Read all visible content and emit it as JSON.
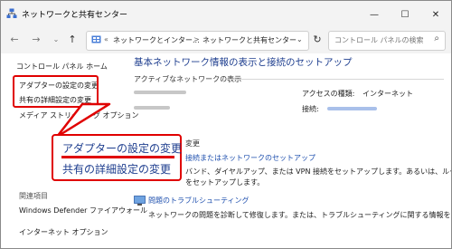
{
  "window": {
    "title": "ネットワークと共有センター",
    "controls": {
      "minimize": "—",
      "maximize": "☐",
      "close": "✕"
    }
  },
  "nav": {
    "back": "←",
    "forward": "→",
    "up": "↑",
    "refresh": "↻"
  },
  "address": {
    "sep": "«",
    "crumb1": "ネットワークとインター...",
    "arrow": ">",
    "crumb2": "ネットワークと共有センター",
    "dropdown": "⌄"
  },
  "search": {
    "placeholder": "コントロール パネルの検索",
    "icon": "⌕"
  },
  "sidebar": {
    "home": "コントロール パネル ホーム",
    "adapter": "アダプターの設定の変更",
    "sharing": "共有の詳細設定の変更",
    "media": "メディア ストリーミング オプション",
    "related_title": "関連項目",
    "defender": "Windows Defender ファイアウォール",
    "internet_options": "インターネット オプション"
  },
  "main": {
    "heading": "基本ネットワーク情報の表示と接続のセットアップ",
    "active_label": "アクティブなネットワークの表示",
    "access_type_label": "アクセスの種類:",
    "access_type_value": "インターネット",
    "connection_label": "接続:",
    "change_label": "ネットワーク設定の変更",
    "change_label_visible": "変更",
    "new_connection_link": "新しい接続またはネットワークのセットアップ",
    "new_connection_link_visible": "接続またはネットワークのセットアップ",
    "new_connection_desc": "ブロードバンド、ダイヤルアップ、または VPN 接続をセットアップします。あるいは、ルーターまたはアクセス",
    "new_connection_desc_visible": "バンド、ダイヤルアップ、または VPN 接続をセットアップします。あるいは、ルーターまたはアクセス",
    "new_connection_desc2": "ポイントをセットアップします。",
    "new_connection_desc2_visible": "をセットアップします。",
    "troubleshoot_link": "問題のトラブルシューティング",
    "troubleshoot_desc": "ネットワークの問題を診断して修復します。または、トラブルシューティングに関する情報を入手します。"
  },
  "callout": {
    "adapter": "アダプターの設定の変更",
    "sharing": "共有の詳細設定の変更"
  },
  "colors": {
    "highlight": "#e00000",
    "link": "#1e4fae",
    "heading": "#1e3e8f"
  }
}
